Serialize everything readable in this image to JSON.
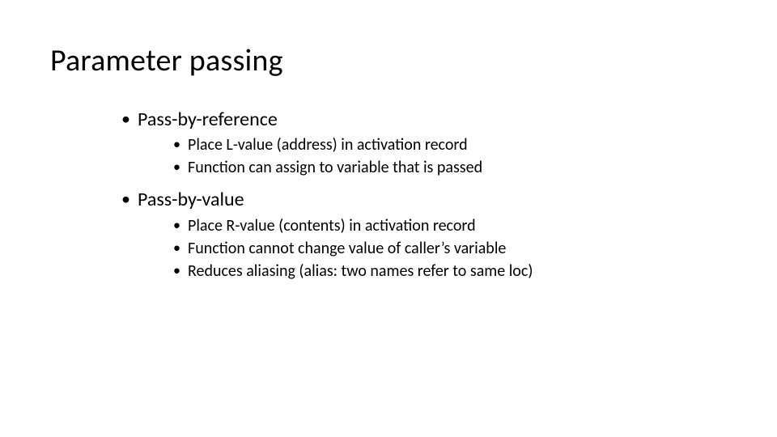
{
  "slide": {
    "title": "Parameter passing",
    "bullets": [
      {
        "text": "Pass-by-reference",
        "sub": [
          "Place L-value (address) in activation record",
          "Function can assign to variable that is passed"
        ]
      },
      {
        "text": "Pass-by-value",
        "sub": [
          "Place R-value (contents) in activation record",
          "Function cannot change value of caller’s variable",
          "Reduces aliasing (alias: two names refer to same loc)"
        ]
      }
    ]
  }
}
